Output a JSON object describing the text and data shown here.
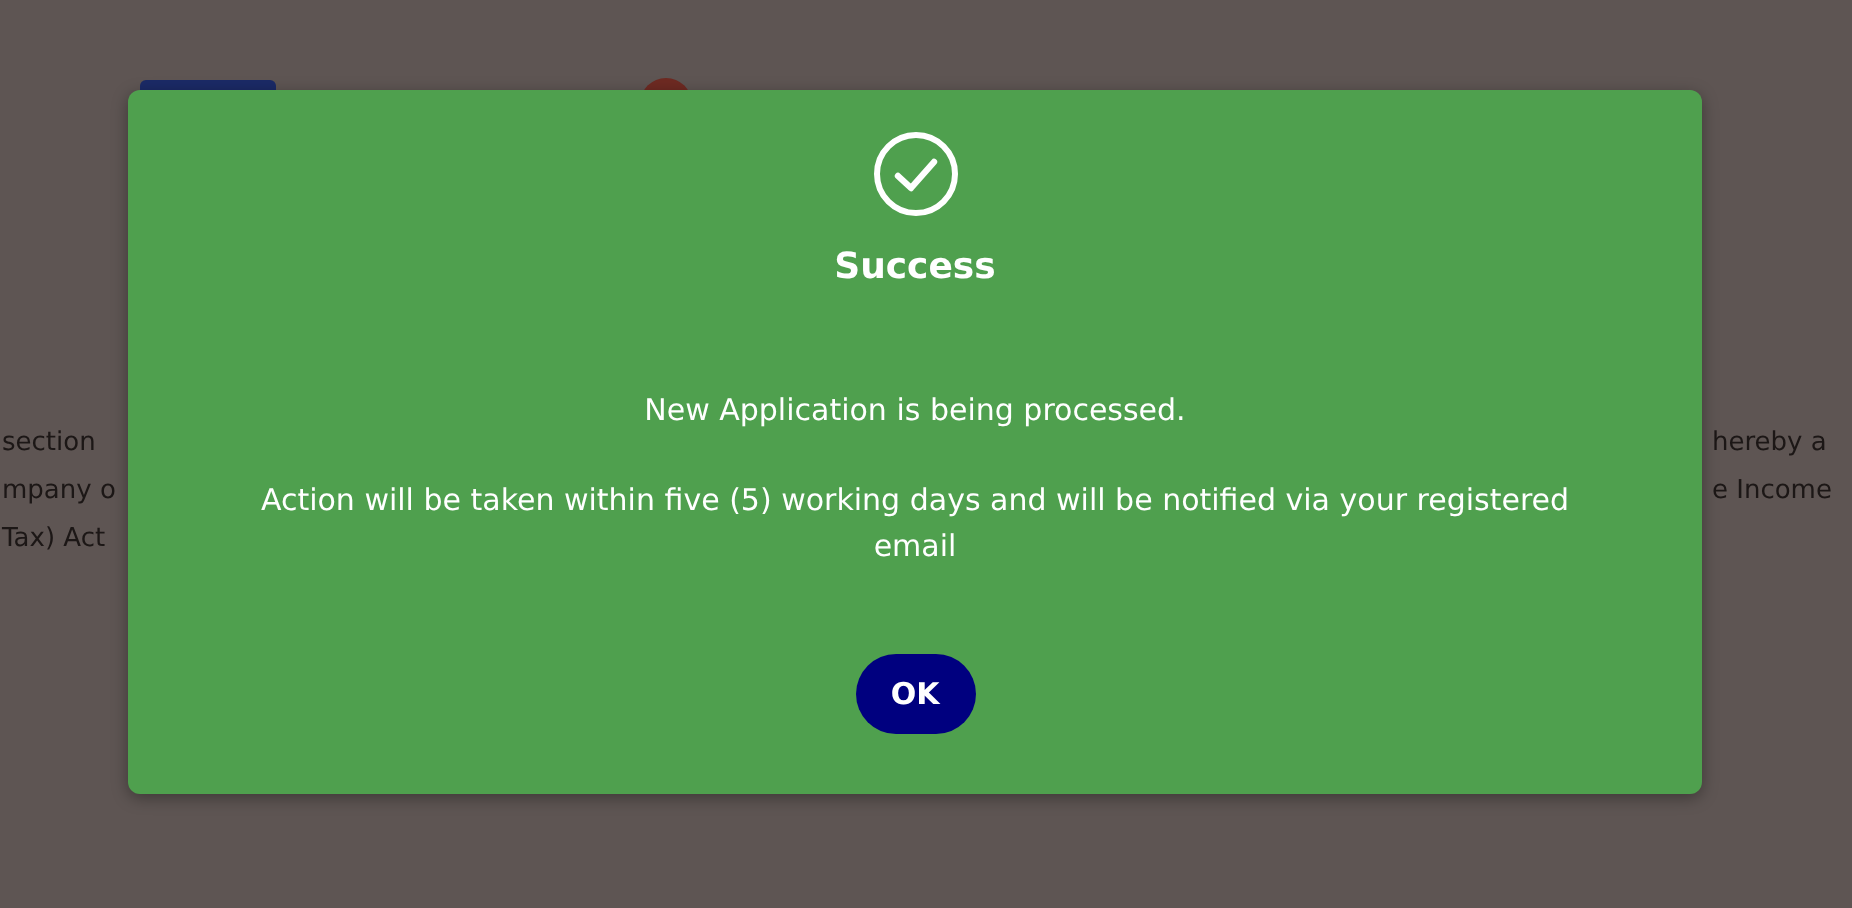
{
  "background": {
    "left_lines": [
      "section",
      "mpany o",
      "Tax) Act"
    ],
    "right_lines": [
      "hereby a",
      "e Income"
    ]
  },
  "dialog": {
    "title": "Success",
    "messages": [
      "New Application is being processed.",
      "Action will be taken within five (5) working days and will be notified via your registered email"
    ],
    "button": "OK"
  }
}
